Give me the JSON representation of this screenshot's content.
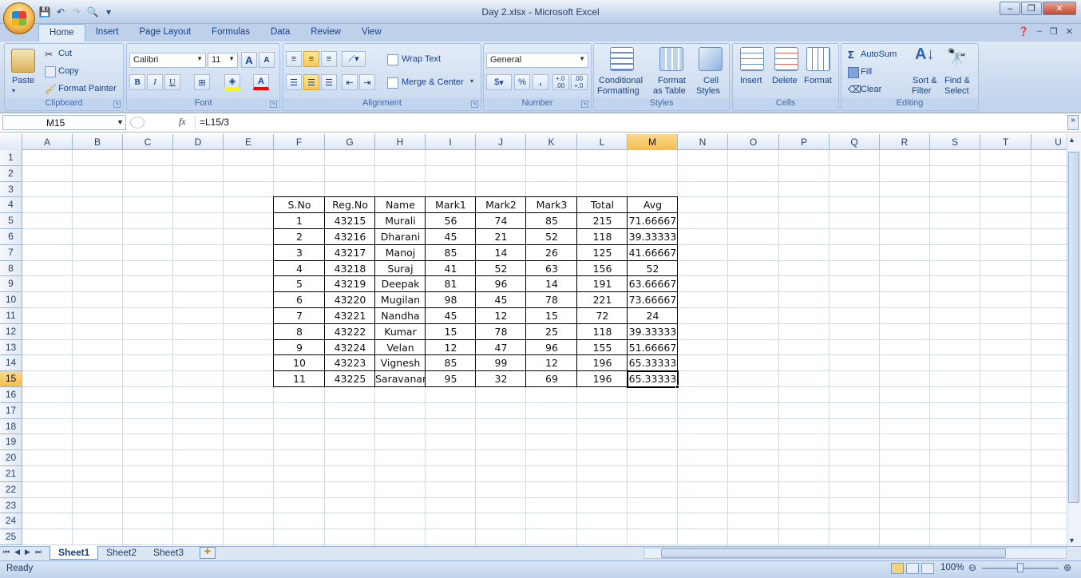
{
  "window": {
    "title": "Day 2.xlsx - Microsoft Excel",
    "controls": {
      "minimize": "–",
      "restore": "❐",
      "close": "✕"
    }
  },
  "ribbon_tabs": [
    "Home",
    "Insert",
    "Page Layout",
    "Formulas",
    "Data",
    "Review",
    "View"
  ],
  "active_tab": "Home",
  "clipboard": {
    "label": "Clipboard",
    "paste": "Paste",
    "cut": "Cut",
    "copy": "Copy",
    "format_painter": "Format Painter"
  },
  "font": {
    "label": "Font",
    "name": "Calibri",
    "size": "11",
    "bold": "B",
    "italic": "I",
    "underline": "U",
    "grow": "A",
    "shrink": "A",
    "font_color": "A",
    "highlight_color": "#ffff00",
    "text_color": "#ff0000"
  },
  "alignment": {
    "label": "Alignment",
    "wrap_text": "Wrap Text",
    "merge_center": "Merge & Center"
  },
  "number": {
    "label": "Number",
    "format": "General",
    "currency": "$",
    "percent": "%",
    "comma": ",",
    "inc_decimal": "+.0 .00",
    "dec_decimal": ".00 +.0"
  },
  "styles": {
    "label": "Styles",
    "conditional_formatting_1": "Conditional",
    "conditional_formatting_2": "Formatting",
    "format_table_1": "Format",
    "format_table_2": "as Table",
    "cell_styles_1": "Cell",
    "cell_styles_2": "Styles"
  },
  "cells": {
    "label": "Cells",
    "insert": "Insert",
    "delete": "Delete",
    "format": "Format"
  },
  "editing": {
    "label": "Editing",
    "autosum": "AutoSum",
    "fill": "Fill",
    "clear": "Clear",
    "sort_filter_1": "Sort &",
    "sort_filter_2": "Filter",
    "find_select_1": "Find &",
    "find_select_2": "Select"
  },
  "formula_bar": {
    "name_box": "M15",
    "fx": "fx",
    "formula": "=L15/3"
  },
  "columns": [
    "A",
    "B",
    "C",
    "D",
    "E",
    "F",
    "G",
    "H",
    "I",
    "J",
    "K",
    "L",
    "M",
    "N",
    "O",
    "P",
    "Q",
    "R",
    "S",
    "T",
    "U"
  ],
  "rows": [
    "1",
    "2",
    "3",
    "4",
    "5",
    "6",
    "7",
    "8",
    "9",
    "10",
    "11",
    "12",
    "13",
    "14",
    "15",
    "16",
    "17",
    "18",
    "19",
    "20",
    "21",
    "22",
    "23",
    "24",
    "25"
  ],
  "selected_cell": {
    "column": "M",
    "row": "15"
  },
  "table": {
    "headers": [
      "S.No",
      "Reg.No",
      "Name",
      "Mark1",
      "Mark2",
      "Mark3",
      "Total",
      "Avg"
    ],
    "rows": [
      [
        "1",
        "43215",
        "Murali",
        "56",
        "74",
        "85",
        "215",
        "71.66667"
      ],
      [
        "2",
        "43216",
        "Dharani",
        "45",
        "21",
        "52",
        "118",
        "39.33333"
      ],
      [
        "3",
        "43217",
        "Manoj",
        "85",
        "14",
        "26",
        "125",
        "41.66667"
      ],
      [
        "4",
        "43218",
        "Suraj",
        "41",
        "52",
        "63",
        "156",
        "52"
      ],
      [
        "5",
        "43219",
        "Deepak",
        "81",
        "96",
        "14",
        "191",
        "63.66667"
      ],
      [
        "6",
        "43220",
        "Mugilan",
        "98",
        "45",
        "78",
        "221",
        "73.66667"
      ],
      [
        "7",
        "43221",
        "Nandha",
        "45",
        "12",
        "15",
        "72",
        "24"
      ],
      [
        "8",
        "43222",
        "Kumar",
        "15",
        "78",
        "25",
        "118",
        "39.33333"
      ],
      [
        "9",
        "43224",
        "Velan",
        "12",
        "47",
        "96",
        "155",
        "51.66667"
      ],
      [
        "10",
        "43223",
        "Vignesh",
        "85",
        "99",
        "12",
        "196",
        "65.33333"
      ],
      [
        "11",
        "43225",
        "Saravanan",
        "95",
        "32",
        "69",
        "196",
        "65.33333"
      ]
    ]
  },
  "sheets": [
    "Sheet1",
    "Sheet2",
    "Sheet3"
  ],
  "active_sheet": "Sheet1",
  "status": {
    "ready": "Ready",
    "zoom": "100%"
  }
}
